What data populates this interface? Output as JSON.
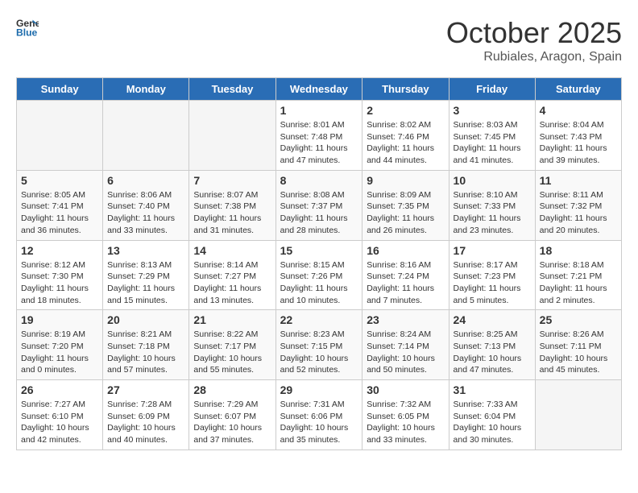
{
  "header": {
    "logo_general": "General",
    "logo_blue": "Blue",
    "month": "October 2025",
    "location": "Rubiales, Aragon, Spain"
  },
  "weekdays": [
    "Sunday",
    "Monday",
    "Tuesday",
    "Wednesday",
    "Thursday",
    "Friday",
    "Saturday"
  ],
  "weeks": [
    [
      {
        "day": "",
        "empty": true
      },
      {
        "day": "",
        "empty": true
      },
      {
        "day": "",
        "empty": true
      },
      {
        "day": "1",
        "sunrise": "8:01 AM",
        "sunset": "7:48 PM",
        "daylight": "11 hours and 47 minutes."
      },
      {
        "day": "2",
        "sunrise": "8:02 AM",
        "sunset": "7:46 PM",
        "daylight": "11 hours and 44 minutes."
      },
      {
        "day": "3",
        "sunrise": "8:03 AM",
        "sunset": "7:45 PM",
        "daylight": "11 hours and 41 minutes."
      },
      {
        "day": "4",
        "sunrise": "8:04 AM",
        "sunset": "7:43 PM",
        "daylight": "11 hours and 39 minutes."
      }
    ],
    [
      {
        "day": "5",
        "sunrise": "8:05 AM",
        "sunset": "7:41 PM",
        "daylight": "11 hours and 36 minutes."
      },
      {
        "day": "6",
        "sunrise": "8:06 AM",
        "sunset": "7:40 PM",
        "daylight": "11 hours and 33 minutes."
      },
      {
        "day": "7",
        "sunrise": "8:07 AM",
        "sunset": "7:38 PM",
        "daylight": "11 hours and 31 minutes."
      },
      {
        "day": "8",
        "sunrise": "8:08 AM",
        "sunset": "7:37 PM",
        "daylight": "11 hours and 28 minutes."
      },
      {
        "day": "9",
        "sunrise": "8:09 AM",
        "sunset": "7:35 PM",
        "daylight": "11 hours and 26 minutes."
      },
      {
        "day": "10",
        "sunrise": "8:10 AM",
        "sunset": "7:33 PM",
        "daylight": "11 hours and 23 minutes."
      },
      {
        "day": "11",
        "sunrise": "8:11 AM",
        "sunset": "7:32 PM",
        "daylight": "11 hours and 20 minutes."
      }
    ],
    [
      {
        "day": "12",
        "sunrise": "8:12 AM",
        "sunset": "7:30 PM",
        "daylight": "11 hours and 18 minutes."
      },
      {
        "day": "13",
        "sunrise": "8:13 AM",
        "sunset": "7:29 PM",
        "daylight": "11 hours and 15 minutes."
      },
      {
        "day": "14",
        "sunrise": "8:14 AM",
        "sunset": "7:27 PM",
        "daylight": "11 hours and 13 minutes."
      },
      {
        "day": "15",
        "sunrise": "8:15 AM",
        "sunset": "7:26 PM",
        "daylight": "11 hours and 10 minutes."
      },
      {
        "day": "16",
        "sunrise": "8:16 AM",
        "sunset": "7:24 PM",
        "daylight": "11 hours and 7 minutes."
      },
      {
        "day": "17",
        "sunrise": "8:17 AM",
        "sunset": "7:23 PM",
        "daylight": "11 hours and 5 minutes."
      },
      {
        "day": "18",
        "sunrise": "8:18 AM",
        "sunset": "7:21 PM",
        "daylight": "11 hours and 2 minutes."
      }
    ],
    [
      {
        "day": "19",
        "sunrise": "8:19 AM",
        "sunset": "7:20 PM",
        "daylight": "11 hours and 0 minutes."
      },
      {
        "day": "20",
        "sunrise": "8:21 AM",
        "sunset": "7:18 PM",
        "daylight": "10 hours and 57 minutes."
      },
      {
        "day": "21",
        "sunrise": "8:22 AM",
        "sunset": "7:17 PM",
        "daylight": "10 hours and 55 minutes."
      },
      {
        "day": "22",
        "sunrise": "8:23 AM",
        "sunset": "7:15 PM",
        "daylight": "10 hours and 52 minutes."
      },
      {
        "day": "23",
        "sunrise": "8:24 AM",
        "sunset": "7:14 PM",
        "daylight": "10 hours and 50 minutes."
      },
      {
        "day": "24",
        "sunrise": "8:25 AM",
        "sunset": "7:13 PM",
        "daylight": "10 hours and 47 minutes."
      },
      {
        "day": "25",
        "sunrise": "8:26 AM",
        "sunset": "7:11 PM",
        "daylight": "10 hours and 45 minutes."
      }
    ],
    [
      {
        "day": "26",
        "sunrise": "7:27 AM",
        "sunset": "6:10 PM",
        "daylight": "10 hours and 42 minutes."
      },
      {
        "day": "27",
        "sunrise": "7:28 AM",
        "sunset": "6:09 PM",
        "daylight": "10 hours and 40 minutes."
      },
      {
        "day": "28",
        "sunrise": "7:29 AM",
        "sunset": "6:07 PM",
        "daylight": "10 hours and 37 minutes."
      },
      {
        "day": "29",
        "sunrise": "7:31 AM",
        "sunset": "6:06 PM",
        "daylight": "10 hours and 35 minutes."
      },
      {
        "day": "30",
        "sunrise": "7:32 AM",
        "sunset": "6:05 PM",
        "daylight": "10 hours and 33 minutes."
      },
      {
        "day": "31",
        "sunrise": "7:33 AM",
        "sunset": "6:04 PM",
        "daylight": "10 hours and 30 minutes."
      },
      {
        "day": "",
        "empty": true
      }
    ]
  ]
}
